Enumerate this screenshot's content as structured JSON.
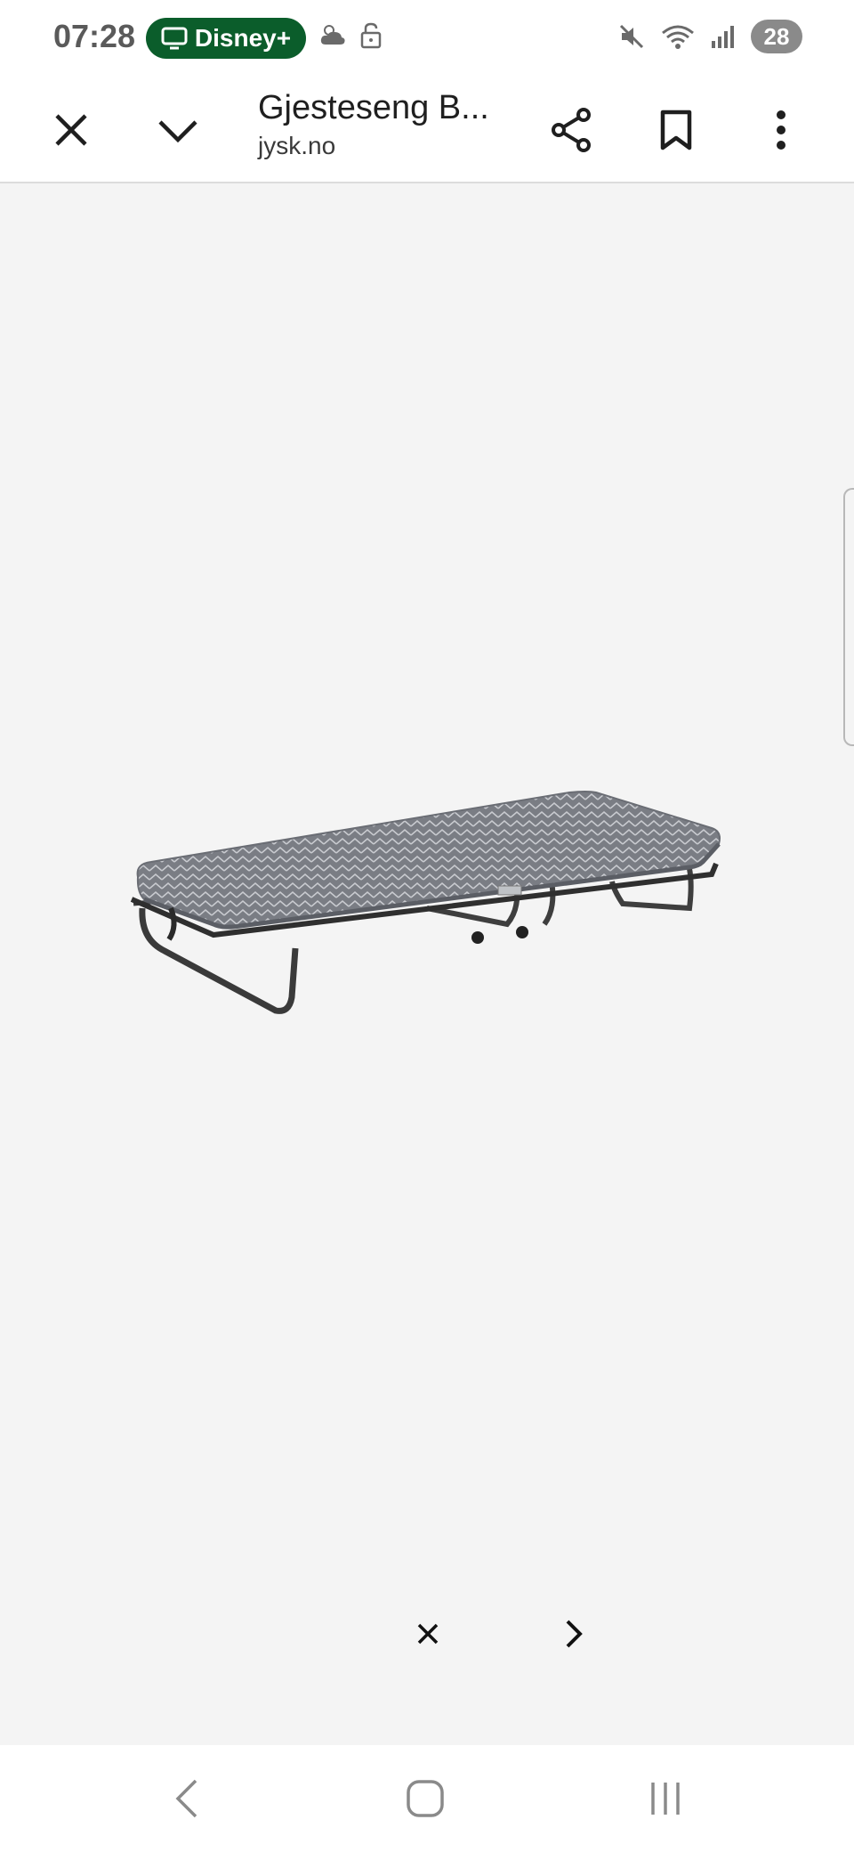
{
  "status_bar": {
    "time": "07:28",
    "pill_label": "Disney+",
    "battery": "28",
    "icons": [
      "tv-icon",
      "weather-icon",
      "unlock-icon",
      "mute-icon",
      "wifi-icon",
      "signal-icon"
    ]
  },
  "toolbar": {
    "title": "Gjesteseng B...",
    "domain": "jysk.no",
    "icons": [
      "close-icon",
      "chevron-down-icon",
      "share-icon",
      "bookmark-icon",
      "more-vert-icon"
    ]
  },
  "image_viewer": {
    "image_subject": "folding guest bed with grey mattress",
    "controls": [
      "close-icon",
      "chevron-right-icon"
    ]
  },
  "nav_bar": {
    "icons": [
      "back-icon",
      "home-icon",
      "recents-icon"
    ]
  },
  "colors": {
    "pill_green": "#0b5d2b",
    "background": "#f4f4f4",
    "surface": "#ffffff"
  }
}
